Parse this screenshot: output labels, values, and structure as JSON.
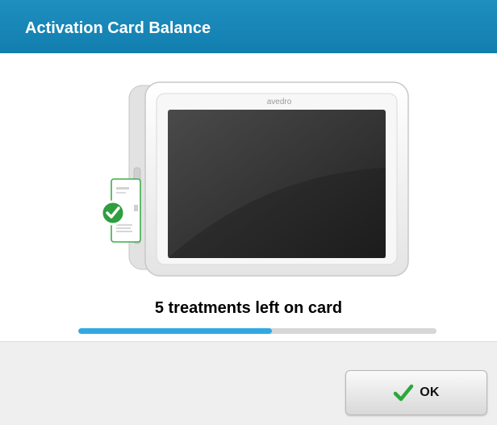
{
  "dialog": {
    "title": "Activation Card Balance",
    "accent_color": "#1b89b8"
  },
  "device": {
    "brand": "avedro",
    "card_status_icon": "check-circle-icon",
    "card_status_color": "#2e9e3e"
  },
  "status": {
    "text": "5 treatments left on card",
    "progress_fraction": 0.54,
    "progress_color": "#31a9e0",
    "track_color": "#d7d7d7"
  },
  "buttons": {
    "ok_label": "OK",
    "ok_icon": "checkmark-icon",
    "ok_icon_color": "#2aa83a"
  }
}
